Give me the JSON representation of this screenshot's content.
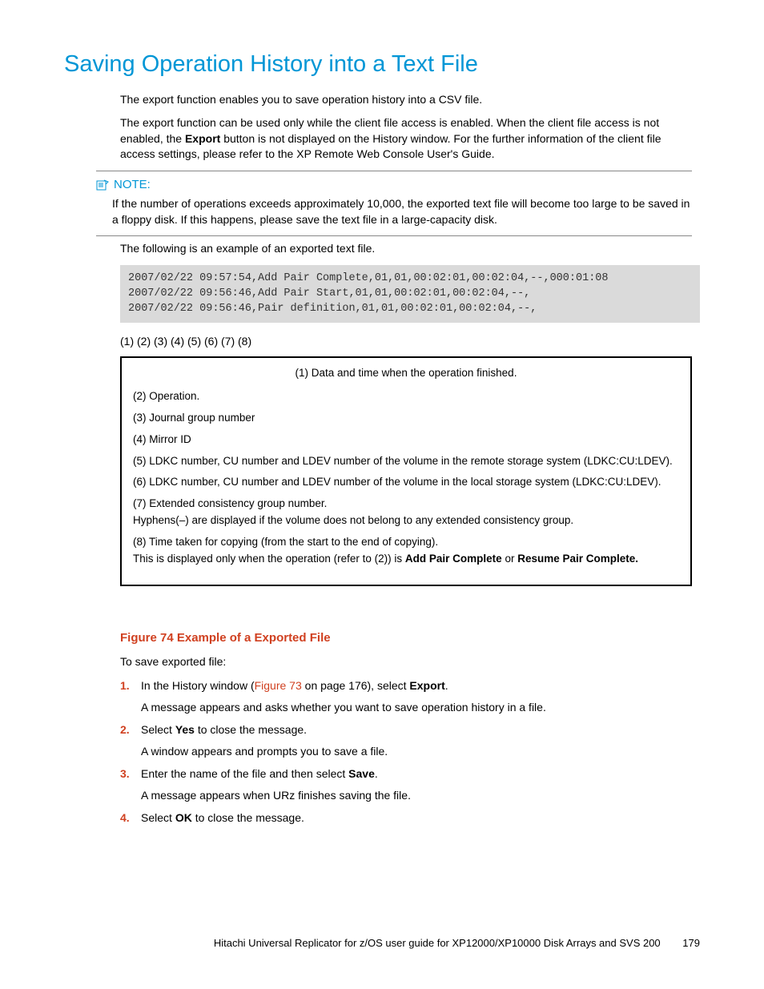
{
  "title": "Saving Operation History into a Text File",
  "intro_p1": "The export function enables you to save operation history into a CSV file.",
  "intro_p2_a": "The export function can be used only while the client file access is enabled. When the client file access is not enabled, the ",
  "intro_p2_bold": "Export",
  "intro_p2_b": " button is not displayed on the History window. For the further information of the client file access settings, please refer to the XP Remote Web Console User's Guide.",
  "note_label": "NOTE:",
  "note_body": "If the number of operations exceeds approximately 10,000, the exported text file will become too large to be saved in a floppy disk. If this happens, please save the text file in a large-capacity disk.",
  "example_intro": "The following is an example of an exported text file.",
  "code_lines": "2007/02/22 09:57:54,Add Pair Complete,01,01,00:02:01,00:02:04,--,000:01:08\n2007/02/22 09:56:46,Add Pair Start,01,01,00:02:01,00:02:04,--,\n2007/02/22 09:56:46,Pair definition,01,01,00:02:01,00:02:04,--,",
  "columns_label": "(1) (2) (3) (4) (5) (6) (7) (8)",
  "legend": {
    "l1": "(1) Data and time when the operation finished.",
    "l2": "(2) Operation.",
    "l3": "(3) Journal group number",
    "l4": "(4) Mirror ID",
    "l5": "(5) LDKC number, CU number and LDEV number of the volume in the remote storage system (LDKC:CU:LDEV).",
    "l6": "(6) LDKC number, CU number and LDEV number of the volume in the local storage system (LDKC:CU:LDEV).",
    "l7a": "(7) Extended consistency group number.",
    "l7b": "Hyphens(–) are displayed if the volume does not belong to any extended consistency group.",
    "l8a": "(8) Time taken for copying (from the start to the end of copying).",
    "l8b_pre": "This is displayed only when the operation (refer to (2)) is ",
    "l8b_bold1": "Add Pair Complete",
    "l8b_mid": " or ",
    "l8b_bold2": "Resume Pair Complete."
  },
  "figure_caption": "Figure 74 Example of a Exported File",
  "save_intro": "To save exported file:",
  "steps": {
    "s1_num": "1.",
    "s1_a": "In the History window (",
    "s1_link": "Figure 73",
    "s1_b": " on page 176), select ",
    "s1_bold": "Export",
    "s1_c": ".",
    "s1_p2": "A message appears and asks whether you want to save operation history in a file.",
    "s2_num": "2.",
    "s2_a": "Select ",
    "s2_bold": "Yes",
    "s2_b": " to close the message.",
    "s2_p2": "A window appears and prompts you to save a file.",
    "s3_num": "3.",
    "s3_a": "Enter the name of the file and then select ",
    "s3_bold": "Save",
    "s3_b": ".",
    "s3_p2": "A message appears when URz finishes saving the file.",
    "s4_num": "4.",
    "s4_a": "Select ",
    "s4_bold": "OK",
    "s4_b": " to close the message."
  },
  "footer_text": "Hitachi Universal Replicator for z/OS user guide for XP12000/XP10000 Disk Arrays and SVS 200",
  "page_number": "179"
}
